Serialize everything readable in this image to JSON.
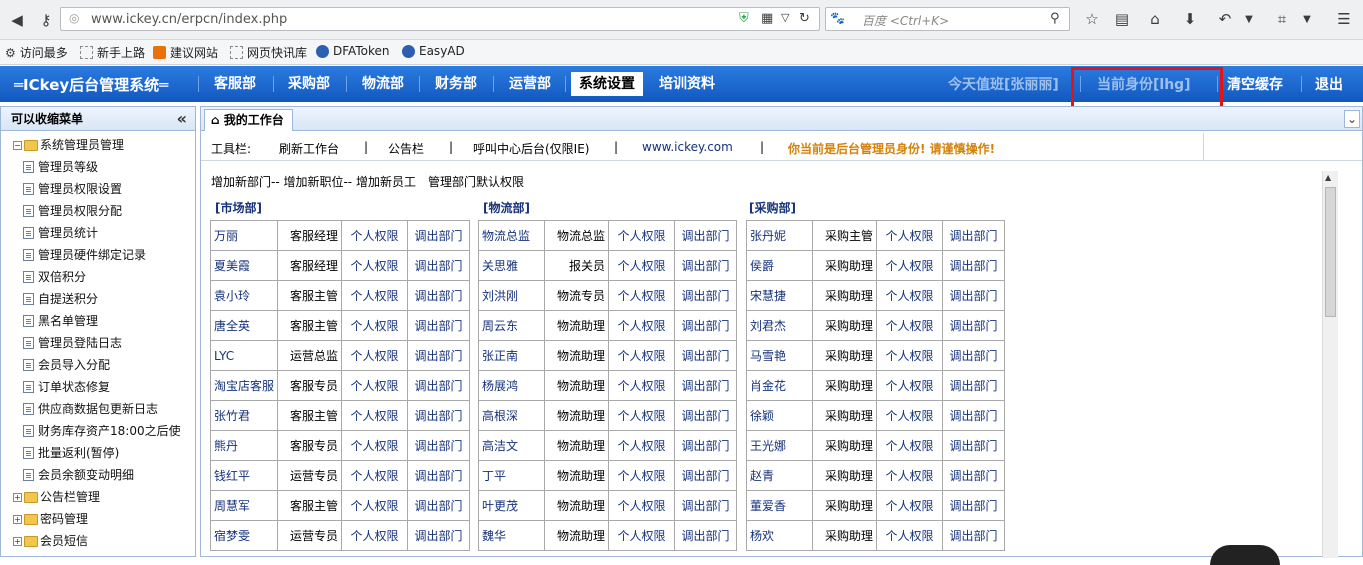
{
  "browser": {
    "url": "www.ickey.cn/erpcn/index.php",
    "search_placeholder": "百度 <Ctrl+K>",
    "bookmarks": [
      "访问最多",
      "新手上路",
      "建议网站",
      "网页快讯库",
      "DFAToken",
      "EasyAD"
    ]
  },
  "nav": {
    "logo": "═ICkey后台管理系统═",
    "items": [
      "客服部",
      "采购部",
      "物流部",
      "财务部",
      "运营部",
      "系统设置",
      "培训资料"
    ],
    "active": "系统设置",
    "duty": "今天值班[张丽丽]",
    "identity": "当前身份[lhg]",
    "clear_cache": "清空缓存",
    "logout": "退出"
  },
  "sidebar": {
    "title": "可以收缩菜单",
    "root": "系统管理员管理",
    "items": [
      "管理员等级",
      "管理员权限设置",
      "管理员权限分配",
      "管理员统计",
      "管理员硬件绑定记录",
      "双倍积分",
      "自提送积分",
      "黑名单管理",
      "管理员登陆日志",
      "会员导入分配",
      "订单状态修复",
      "供应商数据包更新日志",
      "财务库存资产18:00之后使",
      "批量返利(暂停)",
      "会员余额变动明细"
    ],
    "folders": [
      "公告栏管理",
      "密码管理",
      "会员短信"
    ]
  },
  "main": {
    "tab": "我的工作台",
    "toolbar_label": "工具栏:",
    "toolbar_items": [
      "刷新工作台",
      "公告栏",
      "呼叫中心后台(仅限IE)",
      "www.ickey.com"
    ],
    "warning": "你当前是后台管理员身份! 请谨慎操作!",
    "links": "增加新部门-- 增加新职位-- 增加新员工　管理部门默认权限",
    "perm_label": "个人权限",
    "out_label": "调出部门"
  },
  "departments": [
    {
      "name": "[市场部]",
      "staff": [
        {
          "name": "万丽",
          "role": "客服经理"
        },
        {
          "name": "夏美霞",
          "role": "客服经理"
        },
        {
          "name": "袁小玲",
          "role": "客服主管"
        },
        {
          "name": "唐全英",
          "role": "客服主管"
        },
        {
          "name": "LYC",
          "role": "运营总监"
        },
        {
          "name": "淘宝店客服",
          "role": "客服专员"
        },
        {
          "name": "张竹君",
          "role": "客服主管"
        },
        {
          "name": "熊丹",
          "role": "客服专员"
        },
        {
          "name": "钱红平",
          "role": "运营专员"
        },
        {
          "name": "周慧军",
          "role": "客服主管"
        },
        {
          "name": "宿梦雯",
          "role": "运营专员"
        }
      ]
    },
    {
      "name": "[物流部]",
      "staff": [
        {
          "name": "物流总监",
          "role": "物流总监"
        },
        {
          "name": "关思雅",
          "role": "报关员"
        },
        {
          "name": "刘洪刚",
          "role": "物流专员"
        },
        {
          "name": "周云东",
          "role": "物流助理"
        },
        {
          "name": "张正南",
          "role": "物流助理"
        },
        {
          "name": "杨展鸿",
          "role": "物流助理"
        },
        {
          "name": "高根深",
          "role": "物流助理"
        },
        {
          "name": "高洁文",
          "role": "物流助理"
        },
        {
          "name": "丁平",
          "role": "物流助理"
        },
        {
          "name": "叶更茂",
          "role": "物流助理"
        },
        {
          "name": "魏华",
          "role": "物流助理"
        }
      ]
    },
    {
      "name": "[采购部]",
      "staff": [
        {
          "name": "张丹妮",
          "role": "采购主管"
        },
        {
          "name": "侯爵",
          "role": "采购助理"
        },
        {
          "name": "宋慧捷",
          "role": "采购助理"
        },
        {
          "name": "刘君杰",
          "role": "采购助理"
        },
        {
          "name": "马雪艳",
          "role": "采购助理"
        },
        {
          "name": "肖金花",
          "role": "采购助理"
        },
        {
          "name": "徐颖",
          "role": "采购助理"
        },
        {
          "name": "王光娜",
          "role": "采购助理"
        },
        {
          "name": "赵青",
          "role": "采购助理"
        },
        {
          "name": "董爱香",
          "role": "采购助理"
        },
        {
          "name": "杨欢",
          "role": "采购助理"
        }
      ]
    }
  ],
  "colors": {
    "nav": "#1a67d2",
    "highlight": "#e2141a",
    "warning": "#d4820a",
    "link": "#15327a"
  }
}
